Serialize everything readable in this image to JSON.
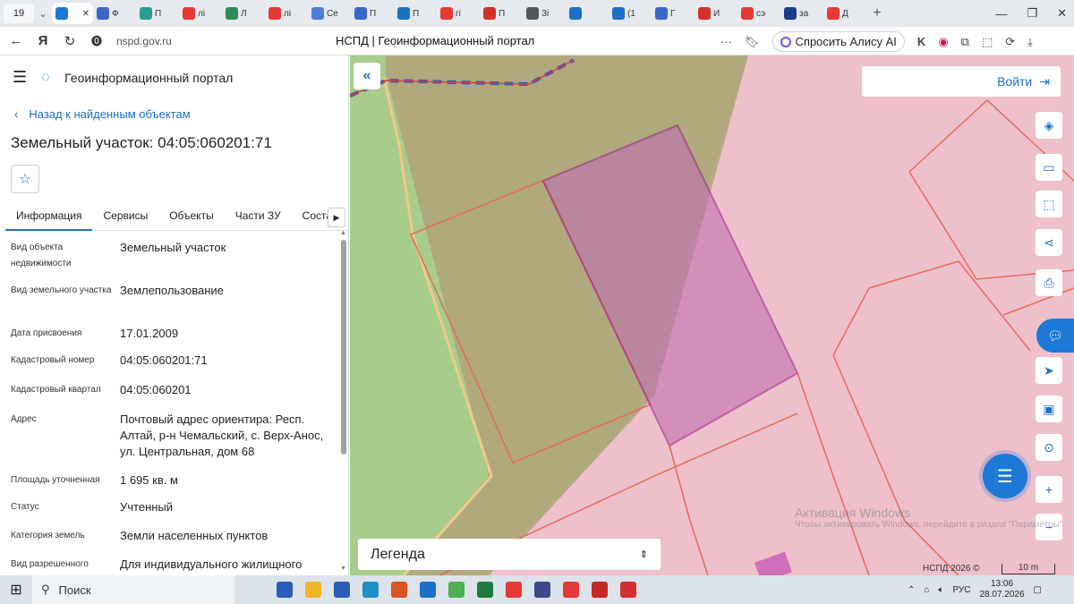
{
  "browser": {
    "tab_count": "19",
    "tabs": [
      {
        "label": "",
        "color": "#1e78d6",
        "icon": "nspd-icon",
        "active": true
      },
      {
        "label": "Ф",
        "color": "#3a67c9",
        "icon": "emblem-icon"
      },
      {
        "label": "П",
        "color": "#2a9d8f",
        "icon": "puzzle-icon"
      },
      {
        "label": "лі",
        "color": "#e53935",
        "icon": "yandex-icon"
      },
      {
        "label": "Л",
        "color": "#2e8b57",
        "icon": "doc-icon"
      },
      {
        "label": "лі",
        "color": "#e53935",
        "icon": "yandex-icon"
      },
      {
        "label": "Се",
        "color": "#4a7bd6",
        "icon": "emblem-icon"
      },
      {
        "label": "П",
        "color": "#3a67c9",
        "icon": "emblem-icon"
      },
      {
        "label": "П",
        "color": "#1e6fc8",
        "icon": "circle-icon"
      },
      {
        "label": "гі",
        "color": "#e53935",
        "icon": "yandex-icon"
      },
      {
        "label": "П",
        "color": "#d32f2f",
        "icon": "mail-icon"
      },
      {
        "label": "Зі",
        "color": "#555555",
        "icon": "avatar-icon"
      },
      {
        "label": "",
        "color": "#1e6fc8",
        "icon": "globe-icon"
      },
      {
        "label": "(1",
        "color": "#1e6fc8",
        "icon": "doc-icon"
      },
      {
        "label": "Г",
        "color": "#3a67c9",
        "icon": "emblem-icon"
      },
      {
        "label": "И",
        "color": "#d32f2f",
        "icon": "rts-icon"
      },
      {
        "label": "сэ",
        "color": "#e53935",
        "icon": "yandex-icon"
      },
      {
        "label": "за",
        "color": "#1e3a8a",
        "icon": "circle-icon"
      },
      {
        "label": "Д",
        "color": "#e53935",
        "icon": "yandex-icon"
      }
    ],
    "url": "nspd.gov.ru",
    "page_title": "НСПД | Геоинформационный портал",
    "alice_label": "Спросить Алису AI"
  },
  "panel": {
    "portal_name": "Геоинформационный портал",
    "back_label": "Назад к найденным объектам",
    "title": "Земельный участок: 04:05:060201:71",
    "tabs": [
      "Информация",
      "Сервисы",
      "Объекты",
      "Части ЗУ",
      "Состав"
    ],
    "properties": [
      {
        "label": "Вид объекта недвижимости",
        "value": "Земельный участок"
      },
      {
        "label": "Вид земельного участка",
        "value": "Землепользование"
      },
      {
        "label": "Дата присвоения",
        "value": "17.01.2009"
      },
      {
        "label": "Кадастровый номер",
        "value": "04:05:060201:71"
      },
      {
        "label": "Кадастровый квартал",
        "value": "04:05:060201"
      },
      {
        "label": "Адрес",
        "value": "Почтовый адрес ориентира: Респ. Алтай, р-н Чемальский, с. Верх-Анос, ул. Центральная, дом 68"
      },
      {
        "label": "Площадь уточненная",
        "value": "1 695 кв. м"
      },
      {
        "label": "Статус",
        "value": "Учтенный"
      },
      {
        "label": "Категория земель",
        "value": "Земли населенных пунктов"
      },
      {
        "label": "Вид разрешенного",
        "value": "Для индивидуального жилищного"
      }
    ]
  },
  "map": {
    "login_label": "Войти",
    "legend_label": "Легенда",
    "copyright": "НСПД 2026 ©",
    "scale": "10 m",
    "watermark_title": "Активация Windows",
    "watermark_text": "Чтобы активировать Windows, перейдите в раздел \"Параметры\".",
    "colors": {
      "green": "#a8cc8a",
      "pink": "#eec0cc",
      "selected": "#c070b0",
      "border": "#e56a5a"
    }
  },
  "taskbar": {
    "search_label": "Поиск",
    "apps": [
      "#2b5cb8",
      "#f0b429",
      "#2b5cb8",
      "#1e90c8",
      "#d9541e",
      "#1e6fc8",
      "#4caf50",
      "#1d7a3e",
      "#e53935",
      "#3a4a8a",
      "#e53935",
      "#c62828",
      "#d32f2f"
    ],
    "lang": "РУС",
    "time": "13:06",
    "date": "28.07.2026"
  }
}
